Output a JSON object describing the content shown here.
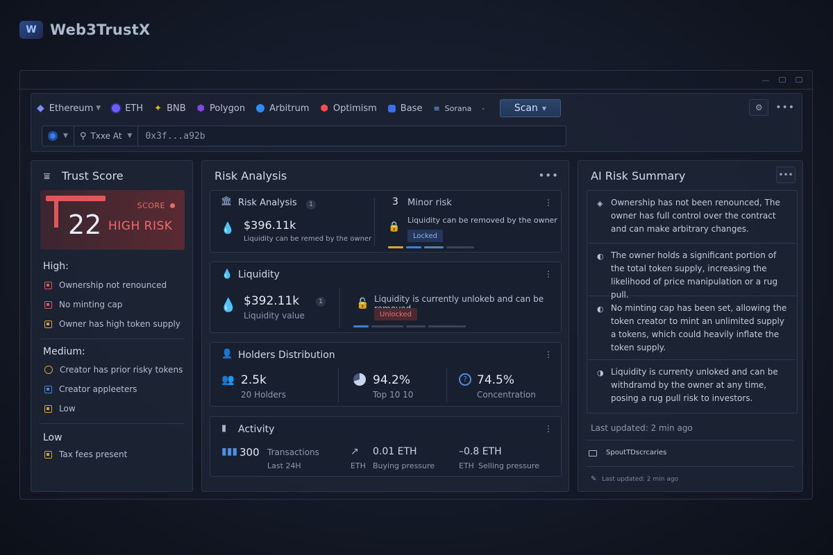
{
  "app": {
    "name": "Web3TrustX",
    "logo_text": "W"
  },
  "toolbar": {
    "chains": [
      {
        "label": "Ethereum",
        "color": "#7c8cff",
        "has_caret": true
      },
      {
        "label": "ETH",
        "color": "#6a5cff"
      },
      {
        "label": "BNB",
        "color": "#f0b90b"
      },
      {
        "label": "Polygon",
        "color": "#8247e5"
      },
      {
        "label": "Arbitrum",
        "color": "#2d8cff"
      },
      {
        "label": "Optimism",
        "color": "#ff4d4d"
      },
      {
        "label": "Base",
        "color": "#3a6df0"
      },
      {
        "label": "Sorana",
        "color": "#7fb6ff",
        "has_caret": true
      }
    ],
    "scan_label": "Scan",
    "address_selector_label": "Txxe At",
    "address_value": "0x3f...a92b"
  },
  "trust": {
    "title": "Trust Score",
    "score": "22",
    "score_label": "SCORE",
    "risk_label": "HIGH RISK",
    "high_title": "High:",
    "high_items": [
      "Ownership not renounced",
      "No minting cap",
      "Owner has high token supply"
    ],
    "medium_title": "Medium:",
    "medium_items": [
      "Creator has prior risky tokens",
      "Creator appleeters",
      "Low"
    ],
    "low_title": "Low",
    "low_items": [
      "Tax fees present"
    ]
  },
  "risk": {
    "title": "Risk Analysis",
    "card1": {
      "title": "Risk Analysis",
      "badge": "1",
      "value": "$396.11k",
      "value_caption": "Liquidity can be remed by the owner",
      "count": "3",
      "count_label": "Minor risk",
      "lock_text": "Liquidity can be removed by the owner",
      "pill": "Locked"
    },
    "card2": {
      "title": "Liquidity",
      "value": "$392.11k",
      "badge": "1",
      "value_caption": "Liquidity value",
      "lock_text": "Liquidity is currently unlokeb and can be removed",
      "pill": "Unlocked"
    },
    "card3": {
      "title": "Holders Distribution",
      "holders_value": "2.5k",
      "holders_caption": "20 Holders",
      "top_value": "94.2%",
      "top_caption": "Top  10  10",
      "conc_value": "74.5%",
      "conc_caption": "Concentration"
    },
    "card4": {
      "title": "Activity",
      "tx_value": "300",
      "tx_label": "Transactions",
      "tx_caption": "Last  24H",
      "buy_value": "0.01 ETH",
      "buy_unit": "ETH",
      "buy_caption": "Buying pressure",
      "sell_value": "–0.8 ETH",
      "sell_unit": "ETH",
      "sell_caption": "Selling pressure"
    }
  },
  "ai": {
    "title": "AI Risk Summary",
    "items": [
      "Ownership has not been renounced, The owner has full control over the contract and can make arbitrary changes.",
      "The owner holds a significant portion of the total token supply, increasing the likelihood of price manipulation or a rug pull.",
      "No minting cap has been set, allowing the token creator to mint an unlimited supply a tokens, which could heavily inflate the token supply.",
      "Liquidity is currenty unloked and can be withdramd by the owner at any time, posing a rug pull risk to investors."
    ],
    "updated": "Last updated: 2 min ago",
    "report": "SpoutTDscrcaries",
    "updated_small": "Last updated: 2 min ago"
  }
}
